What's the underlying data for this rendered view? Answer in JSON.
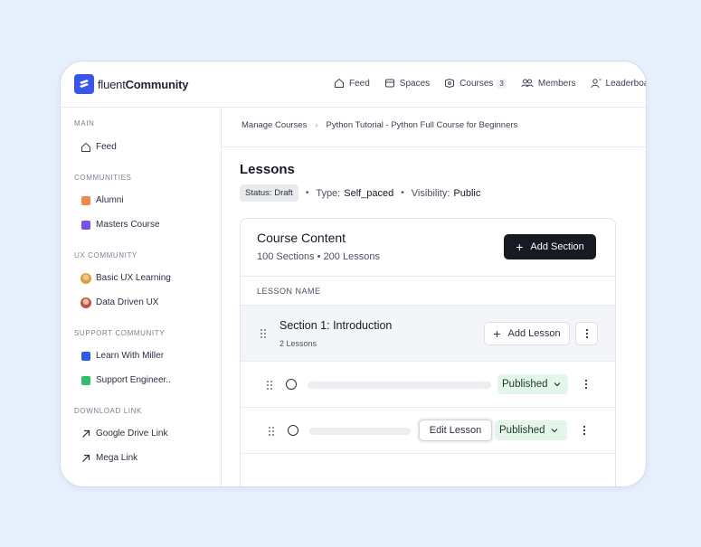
{
  "brand": {
    "prefix": "fluent",
    "name": "Community",
    "color": "#3a56e8"
  },
  "topnav": [
    {
      "label": "Feed",
      "icon": "home-icon"
    },
    {
      "label": "Spaces",
      "icon": "spaces-icon"
    },
    {
      "label": "Courses",
      "icon": "courses-icon",
      "count": "3"
    },
    {
      "label": "Members",
      "icon": "members-icon"
    },
    {
      "label": "Leaderboard",
      "icon": "leaderboard-icon"
    }
  ],
  "sidebar": {
    "main_head": "MAIN",
    "feed": "Feed",
    "communities_head": "COMMUNITIES",
    "communities": [
      {
        "label": "Alumni",
        "color": "#f08a4b"
      },
      {
        "label": "Masters Course",
        "color": "#7b52e8"
      }
    ],
    "ux_head": "UX COMMUNITY",
    "ux": [
      {
        "label": "Basic UX Learning"
      },
      {
        "label": "Data Driven UX"
      }
    ],
    "support_head": "SUPPORT COMMUNITY",
    "support": [
      {
        "label": "Learn With Miller",
        "color": "#2f5be8"
      },
      {
        "label": "Support Engineer..",
        "color": "#2fbf6a"
      }
    ],
    "download_head": "DOWNLOAD LINK",
    "downloads": [
      {
        "label": "Google Drive Link"
      },
      {
        "label": "Mega Link"
      }
    ]
  },
  "breadcrumb": {
    "root": "Manage Courses",
    "current": "Python Tutorial - Python Full Course for Beginners"
  },
  "page": {
    "title": "Lessons",
    "status": "Status: Draft",
    "type_label": "Type:",
    "type_value": "Self_paced",
    "visibility_label": "Visibility:",
    "visibility_value": "Public"
  },
  "course_content": {
    "title": "Course Content",
    "summary": "100 Sections • 200 Lessons",
    "add_section": "Add Section",
    "column_header": "LESSON NAME",
    "section": {
      "title": "Section 1: Introduction",
      "count": "2 Lessons",
      "add_lesson": "Add Lesson"
    },
    "lessons": [
      {
        "status": "Published"
      },
      {
        "status": "Published",
        "edit": "Edit Lesson"
      }
    ]
  }
}
